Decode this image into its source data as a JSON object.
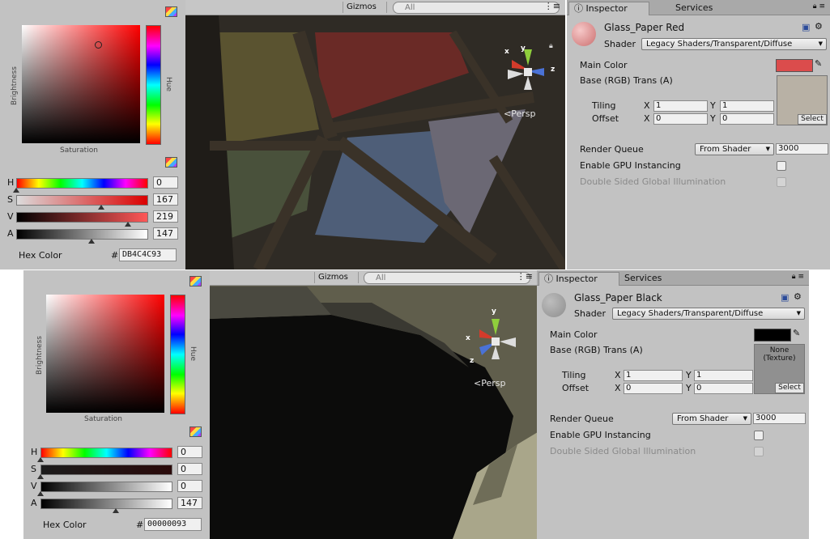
{
  "top": {
    "picker": {
      "hue_color": "#ff0000",
      "labels": {
        "brightness": "Brightness",
        "hue": "Hue",
        "saturation": "Saturation"
      },
      "sliders": [
        {
          "letter": "H",
          "value": "0",
          "fraction": 0.0
        },
        {
          "letter": "S",
          "value": "167",
          "fraction": 0.655
        },
        {
          "letter": "V",
          "value": "219",
          "fraction": 0.859
        },
        {
          "letter": "A",
          "value": "147",
          "fraction": 0.576
        }
      ],
      "hex_label": "Hex Color",
      "hash": "#",
      "hex_value": "DB4C4C93"
    },
    "scene": {
      "gizmos_label": "Gizmos",
      "search_placeholder": "All",
      "persp_label": "Persp",
      "axis": {
        "x": "x",
        "y": "y",
        "z": "z"
      }
    },
    "inspector": {
      "tabs": [
        "Inspector",
        "Services"
      ],
      "material_name": "Glass_Paper Red",
      "shader_label": "Shader",
      "shader_value": "Legacy Shaders/Transparent/Diffuse",
      "main_color_label": "Main Color",
      "main_color": "#db4c4c",
      "base_label": "Base (RGB) Trans (A)",
      "tiling_label": "Tiling",
      "offset_label": "Offset",
      "x_label": "X",
      "y_label": "Y",
      "tiling": {
        "x": "1",
        "y": "1"
      },
      "offset": {
        "x": "0",
        "y": "0"
      },
      "texture_text": "",
      "select_label": "Select",
      "render_queue_label": "Render Queue",
      "render_queue_mode": "From Shader",
      "render_queue_value": "3000",
      "gpu_label": "Enable GPU Instancing",
      "double_sided_label": "Double Sided Global Illumination"
    }
  },
  "bottom": {
    "picker": {
      "hue_color": "#ff0000",
      "labels": {
        "brightness": "Brightness",
        "hue": "Hue",
        "saturation": "Saturation"
      },
      "sliders": [
        {
          "letter": "H",
          "value": "0",
          "fraction": 0.0
        },
        {
          "letter": "S",
          "value": "0",
          "fraction": 0.0
        },
        {
          "letter": "V",
          "value": "0",
          "fraction": 0.0
        },
        {
          "letter": "A",
          "value": "147",
          "fraction": 0.576
        }
      ],
      "hex_label": "Hex Color",
      "hash": "#",
      "hex_value": "00000093"
    },
    "scene": {
      "gizmos_label": "Gizmos",
      "search_placeholder": "All",
      "persp_label": "Persp",
      "axis": {
        "x": "x",
        "y": "y",
        "z": "z"
      }
    },
    "inspector": {
      "tabs": [
        "Inspector",
        "Services"
      ],
      "material_name": "Glass_Paper Black",
      "shader_label": "Shader",
      "shader_value": "Legacy Shaders/Transparent/Diffuse",
      "main_color_label": "Main Color",
      "main_color": "#000000",
      "base_label": "Base (RGB) Trans (A)",
      "tiling_label": "Tiling",
      "offset_label": "Offset",
      "x_label": "X",
      "y_label": "Y",
      "tiling": {
        "x": "1",
        "y": "1"
      },
      "offset": {
        "x": "0",
        "y": "0"
      },
      "texture_text": "None\n(Texture)",
      "select_label": "Select",
      "render_queue_label": "Render Queue",
      "render_queue_mode": "From Shader",
      "render_queue_value": "3000",
      "gpu_label": "Enable GPU Instancing",
      "double_sided_label": "Double Sided Global Illumination"
    }
  }
}
